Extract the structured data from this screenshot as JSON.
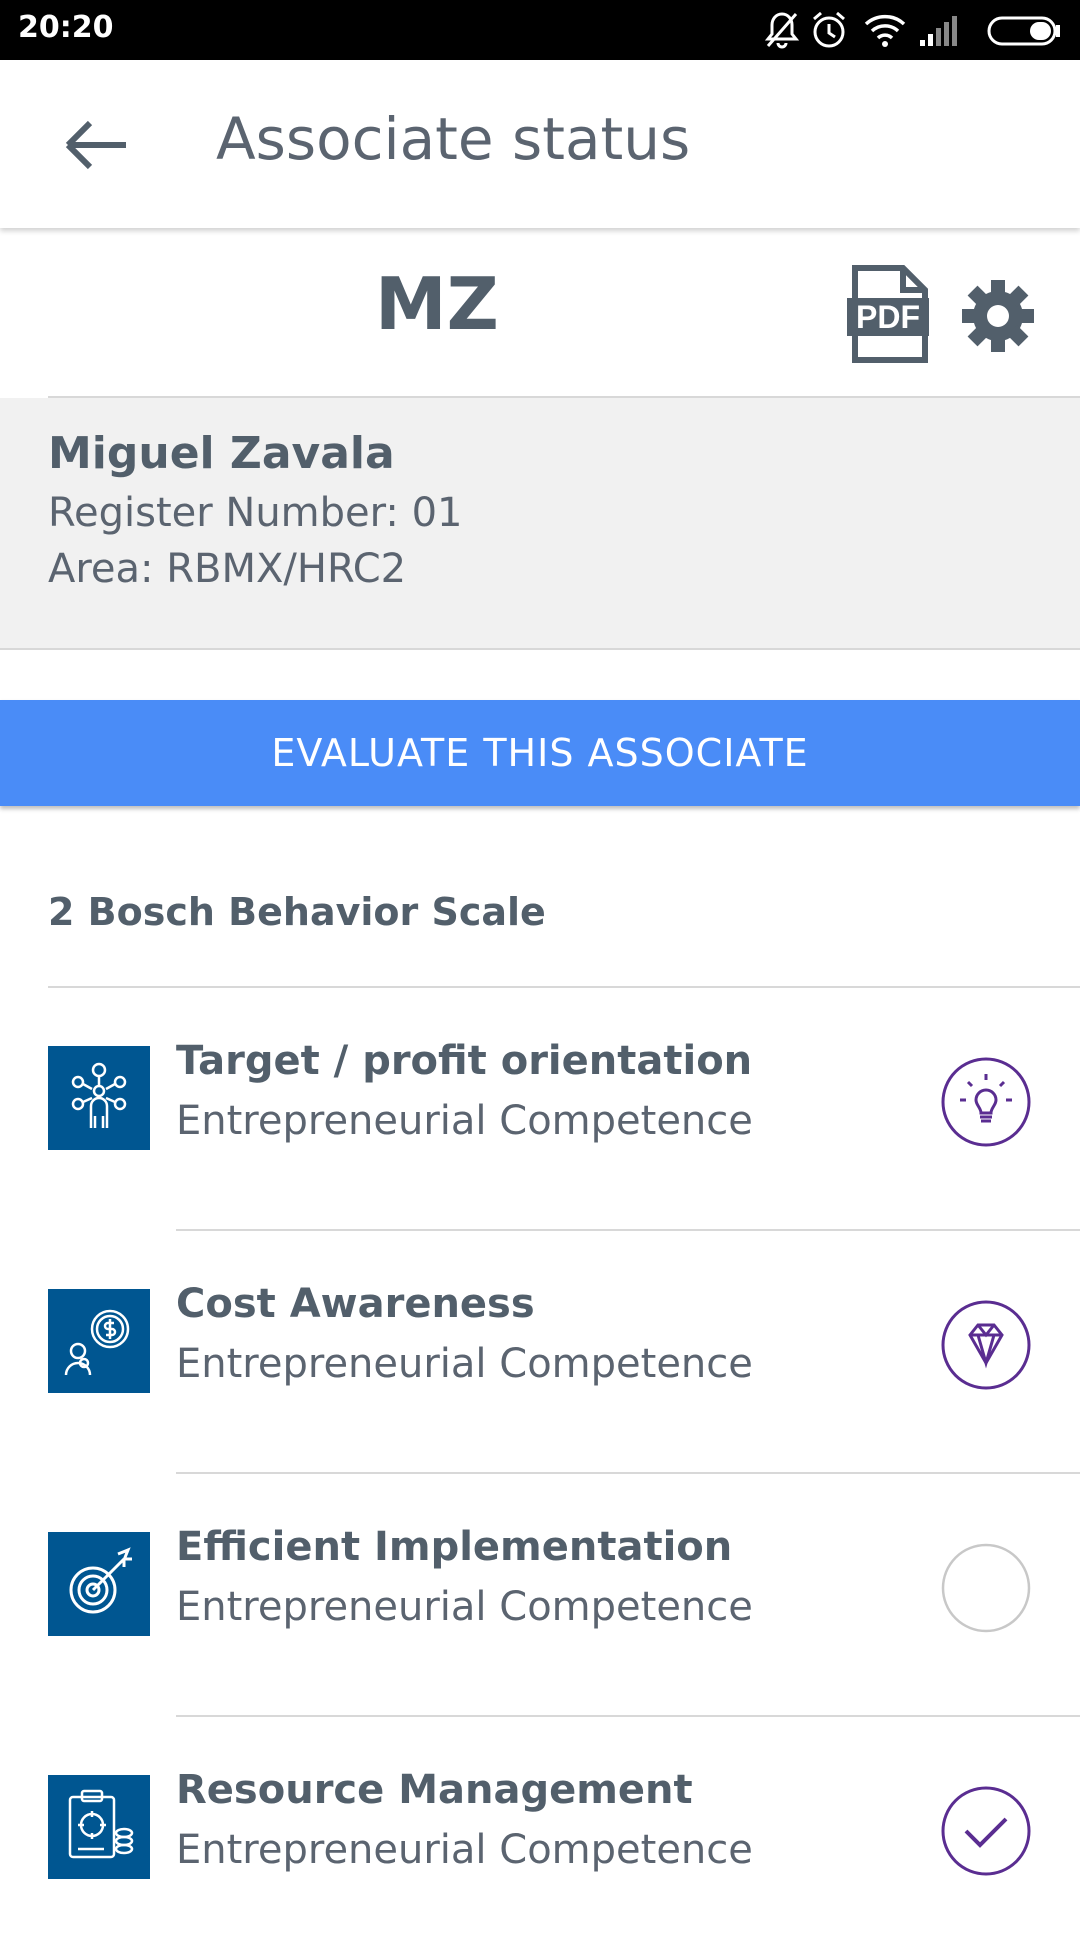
{
  "status_bar": {
    "time": "20:20",
    "icons": [
      "bell-off-icon",
      "alarm-icon",
      "wifi-icon",
      "signal-icon",
      "battery-icon"
    ]
  },
  "app_bar": {
    "title": "Associate status",
    "back_icon": "arrow-left-icon"
  },
  "associate": {
    "initials": "MZ",
    "name": "Miguel Zavala",
    "register_number": "Register Number: 01",
    "area": "Area: RBMX/HRC2"
  },
  "actions": {
    "pdf_icon": "pdf-icon",
    "settings_icon": "gear-icon",
    "evaluate_label": "EVALUATE THIS ASSOCIATE"
  },
  "section": {
    "title": "2 Bosch Behavior Scale"
  },
  "items": [
    {
      "title": "Target / profit orientation",
      "subtitle": "Entrepreneurial Competence",
      "icon": "network-person-icon",
      "status": "lightbulb-icon"
    },
    {
      "title": "Cost Awareness",
      "subtitle": "Entrepreneurial Competence",
      "icon": "dollar-person-icon",
      "status": "diamond-icon"
    },
    {
      "title": "Efficient Implementation",
      "subtitle": "Entrepreneurial Competence",
      "icon": "target-arrow-icon",
      "status": "empty-circle-icon"
    },
    {
      "title": "Resource Management",
      "subtitle": "Entrepreneurial Competence",
      "icon": "clipboard-coins-icon",
      "status": "checkmark-icon"
    }
  ],
  "colors": {
    "accent": "#4a8cf7",
    "tile": "#005691",
    "status_purple": "#5a2d91",
    "text": "#525f6b"
  }
}
